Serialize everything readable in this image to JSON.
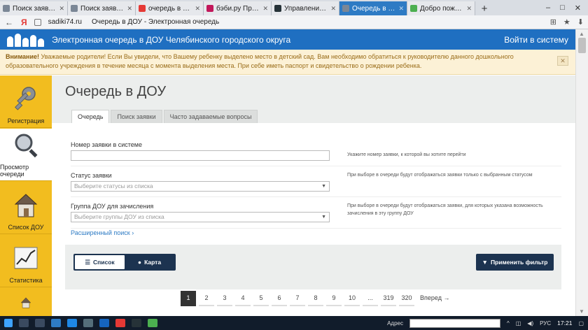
{
  "browser": {
    "tabs": [
      {
        "label": "Поиск заявлений/ос",
        "fav": ""
      },
      {
        "label": "Поиск заявлений/ос",
        "fav": ""
      },
      {
        "label": "очередь в детский с",
        "fav": "y"
      },
      {
        "label": "бэби.ру Прямой эф",
        "fav": "b"
      },
      {
        "label": "Управление образо",
        "fav": "u"
      },
      {
        "label": "Очередь в ДОУ -",
        "fav": "",
        "active": true
      },
      {
        "label": "Добро пожаловать",
        "fav": "g"
      }
    ],
    "new_tab": "+",
    "minimize": "–",
    "maximize": "□",
    "close": "✕",
    "back": "←",
    "yandex_logo": "Я",
    "domain": "sadiki74.ru",
    "page_title": "Очередь в ДОУ - Электронная очередь"
  },
  "site": {
    "title": "Электронная очередь в ДОУ Челябинского городского округа",
    "login": "Войти в систему"
  },
  "notice": {
    "bold": "Внимание!",
    "text": " Уважаемые родители! Если Вы увидели, что Вашему ребенку выделено место в детский сад. Вам необходимо обратиться к руководителю данного дошкольного образовательного учреждения в течение месяца с момента выделения места. При себе иметь паспорт и свидетельство о рождении ребенка.",
    "close": "✕"
  },
  "sidebar": {
    "items": [
      {
        "label": "Регистрация",
        "icon": "key-icon"
      },
      {
        "label": "Просмотр очереди",
        "icon": "magnifier-icon",
        "active": true
      },
      {
        "label": "Список ДОУ",
        "icon": "house-icon"
      },
      {
        "label": "Статистика",
        "icon": "chart-icon"
      },
      {
        "label": "",
        "icon": "house-icon"
      }
    ]
  },
  "main": {
    "title": "Очередь в ДОУ",
    "tabs": [
      "Очередь",
      "Поиск заявки",
      "Часто задаваемые вопросы"
    ],
    "fields": {
      "number": {
        "label": "Номер заявки в системе",
        "value": "",
        "hint": "Укажите номер заявки, к которой вы хотите перейти"
      },
      "status": {
        "label": "Статус заявки",
        "placeholder": "Выберите статусы из списка",
        "hint": "При выборе в очереди будут отображаться заявки только с выбранным статусом"
      },
      "group": {
        "label": "Группа ДОУ для зачисления",
        "placeholder": "Выберите группы ДОУ из списка",
        "hint": "При выборе в очереди будут отображаться заявки, для которых указана возможность зачисления в эту группу ДОУ"
      }
    },
    "advanced_search": "Расширенный поиск ›",
    "view": {
      "list": "Список",
      "map": "Карта"
    },
    "apply_filter": "Применить фильтр",
    "pager": [
      "1",
      "2",
      "3",
      "4",
      "5",
      "6",
      "7",
      "8",
      "9",
      "10",
      "...",
      "319",
      "320"
    ],
    "next": "Вперед →"
  },
  "taskbar": {
    "address_label": "Адрес",
    "lang": "РУС",
    "time": "17:21"
  },
  "colors": {
    "brand_blue": "#1f6fc1",
    "sidebar_yellow": "#f2bd1f",
    "dark_navy": "#1c3350"
  }
}
